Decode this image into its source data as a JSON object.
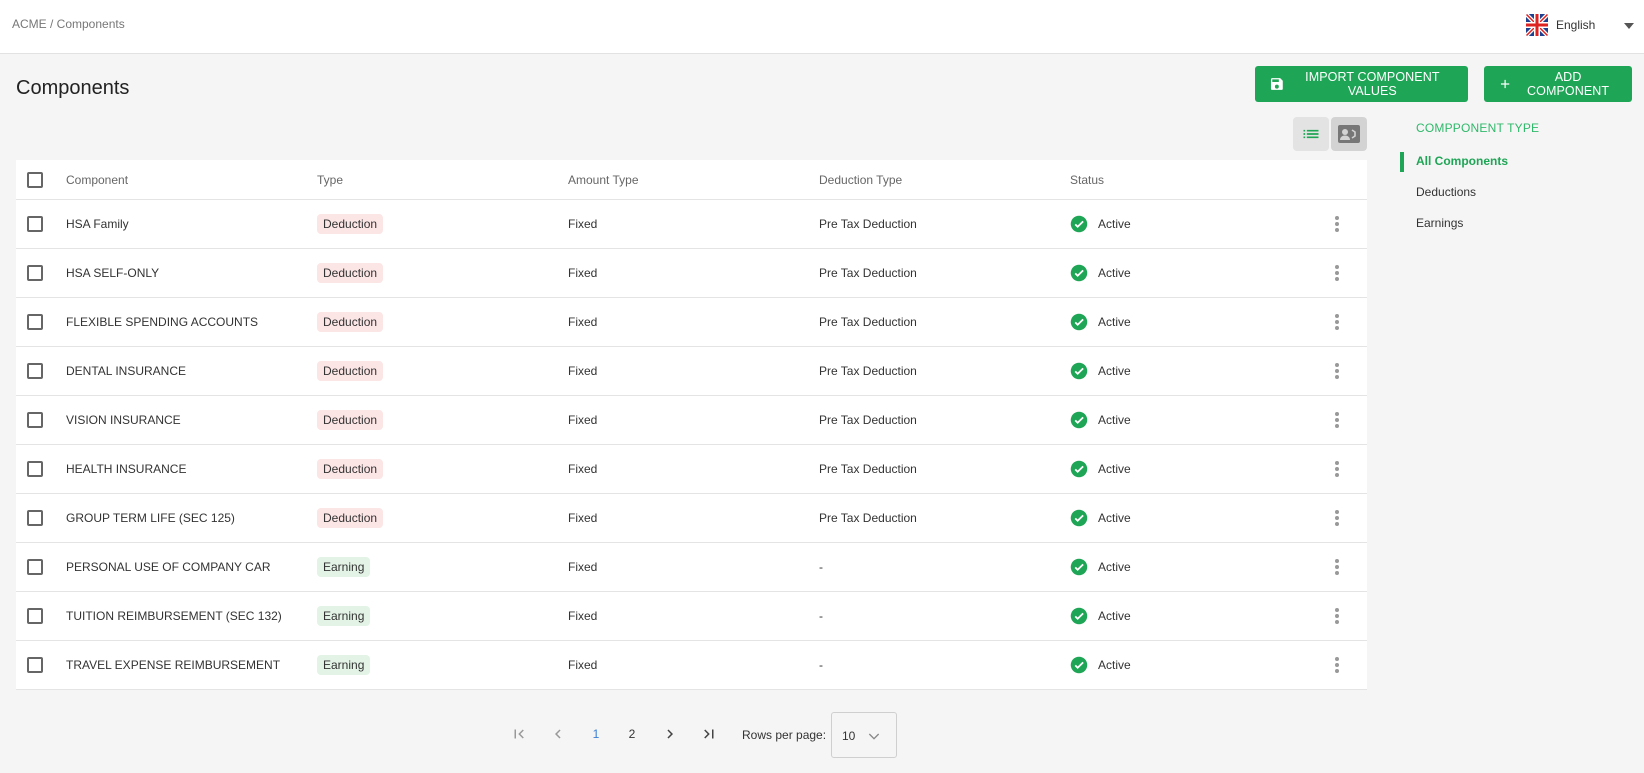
{
  "header": {
    "breadcrumb": "ACME / Components",
    "language": "English"
  },
  "page": {
    "title": "Components",
    "import_label": "IMPORT COMPONENT VALUES",
    "add_label": "ADD COMPONENT"
  },
  "table": {
    "columns": [
      "Component",
      "Type",
      "Amount Type",
      "Deduction Type",
      "Status"
    ],
    "rows": [
      {
        "component": "HSA Family",
        "type": "Deduction",
        "amount_type": "Fixed",
        "deduction_type": "Pre Tax Deduction",
        "status": "Active"
      },
      {
        "component": "HSA SELF-ONLY",
        "type": "Deduction",
        "amount_type": "Fixed",
        "deduction_type": "Pre Tax Deduction",
        "status": "Active"
      },
      {
        "component": "FLEXIBLE SPENDING ACCOUNTS",
        "type": "Deduction",
        "amount_type": "Fixed",
        "deduction_type": "Pre Tax Deduction",
        "status": "Active"
      },
      {
        "component": "DENTAL INSURANCE",
        "type": "Deduction",
        "amount_type": "Fixed",
        "deduction_type": "Pre Tax Deduction",
        "status": "Active"
      },
      {
        "component": "VISION INSURANCE",
        "type": "Deduction",
        "amount_type": "Fixed",
        "deduction_type": "Pre Tax Deduction",
        "status": "Active"
      },
      {
        "component": "HEALTH INSURANCE",
        "type": "Deduction",
        "amount_type": "Fixed",
        "deduction_type": "Pre Tax Deduction",
        "status": "Active"
      },
      {
        "component": "GROUP TERM LIFE (SEC 125)",
        "type": "Deduction",
        "amount_type": "Fixed",
        "deduction_type": "Pre Tax Deduction",
        "status": "Active"
      },
      {
        "component": "PERSONAL USE OF COMPANY CAR",
        "type": "Earning",
        "amount_type": "Fixed",
        "deduction_type": "-",
        "status": "Active"
      },
      {
        "component": "TUITION REIMBURSEMENT (SEC 132)",
        "type": "Earning",
        "amount_type": "Fixed",
        "deduction_type": "-",
        "status": "Active"
      },
      {
        "component": "TRAVEL EXPENSE REIMBURSEMENT",
        "type": "Earning",
        "amount_type": "Fixed",
        "deduction_type": "-",
        "status": "Active"
      }
    ]
  },
  "sidebar": {
    "heading": "COMPPONENT TYPE",
    "items": [
      {
        "label": "All Components",
        "active": true
      },
      {
        "label": "Deductions",
        "active": false
      },
      {
        "label": "Earnings",
        "active": false
      }
    ]
  },
  "pagination": {
    "pages": [
      "1",
      "2"
    ],
    "current": "1",
    "rows_label": "Rows per page:",
    "rows_value": "10"
  },
  "colors": {
    "accent": "#1fa556",
    "deduction_badge": "#fce5e5",
    "earning_badge": "#e3f3e6",
    "active_page": "#3b7fd6"
  },
  "icons": {
    "import": "save-icon",
    "add": "plus-icon",
    "list_view": "list-icon",
    "card_view": "contact-card-icon",
    "status": "check-circle-icon",
    "row_menu": "more-vertical-icon",
    "language": "uk-flag-icon"
  }
}
